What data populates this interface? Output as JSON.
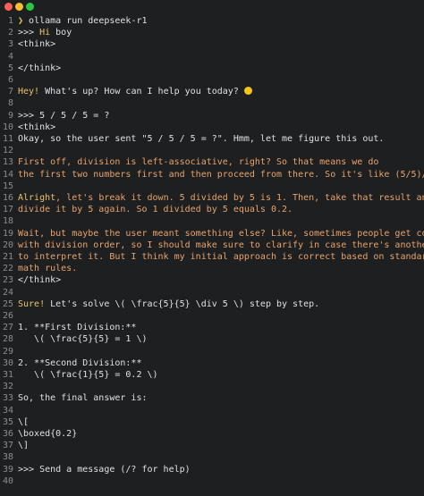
{
  "theme": {
    "background": "#1d1f21",
    "text": "#e0e0e0",
    "accent": "#e9c46a",
    "prose": "#e8a36b",
    "line_numbers": "#8b8d8f"
  },
  "window_controls": [
    "close",
    "minimize",
    "zoom"
  ],
  "lines": [
    {
      "n": "1",
      "pre": "",
      "hl": "❯",
      "rest": " ollama run deepseek-r1",
      "color": "white"
    },
    {
      "n": "2",
      "pre": ">>> ",
      "hl": "Hi",
      "rest": " boy",
      "color": "white"
    },
    {
      "n": "3",
      "pre": "<think>",
      "hl": "",
      "rest": "",
      "color": "white"
    },
    {
      "n": "4",
      "pre": "",
      "hl": "",
      "rest": "",
      "color": "white"
    },
    {
      "n": "5",
      "pre": "</think>",
      "hl": "",
      "rest": "",
      "color": "white"
    },
    {
      "n": "6",
      "pre": "",
      "hl": "",
      "rest": "",
      "color": "white"
    },
    {
      "n": "7",
      "pre": "",
      "hl": "Hey!",
      "rest": " What's up? How can I help you today?",
      "color": "white",
      "emoji": "slightly-smiling-face"
    },
    {
      "n": "8",
      "pre": "",
      "hl": "",
      "rest": "",
      "color": "white"
    },
    {
      "n": "9",
      "pre": ">>> 5 / 5 / 5 = ?",
      "hl": "",
      "rest": "",
      "color": "white"
    },
    {
      "n": "10",
      "pre": "<think>",
      "hl": "",
      "rest": "",
      "color": "white"
    },
    {
      "n": "11",
      "pre": "Okay, so the user sent \"5 / 5 / 5 = ?\". Hmm, let me figure this out.",
      "hl": "",
      "rest": "",
      "color": "white"
    },
    {
      "n": "12",
      "pre": "",
      "hl": "",
      "rest": "",
      "color": "white"
    },
    {
      "n": "13",
      "pre": "First off, division is left-associative, right? So that means we do",
      "hl": "",
      "rest": "",
      "color": "orange"
    },
    {
      "n": "14",
      "pre": "the first two numbers first and then proceed from there. So it's like ",
      "hl": "",
      "rest": "(5/5)/5.",
      "color": "orange"
    },
    {
      "n": "15",
      "pre": "",
      "hl": "",
      "rest": "",
      "color": "white"
    },
    {
      "n": "16",
      "pre": "",
      "hl": "Alright",
      "rest": ", let's break it down. 5 divided by 5 is 1. Then, take that result and",
      "color": "orange"
    },
    {
      "n": "17",
      "pre": "divide it by 5 again. So 1 divided by 5 equals 0.2.",
      "hl": "",
      "rest": "",
      "color": "orange"
    },
    {
      "n": "18",
      "pre": "",
      "hl": "",
      "rest": "",
      "color": "white"
    },
    {
      "n": "19",
      "pre": "Wait, but maybe the user meant something else? Like, sometimes people get confused",
      "hl": "",
      "rest": "",
      "color": "orange"
    },
    {
      "n": "20",
      "pre": "with division order, so I should make sure to clarify in case there's another way",
      "hl": "",
      "rest": "",
      "color": "orange"
    },
    {
      "n": "21",
      "pre": "to interpret it. But I think my initial approach is correct based on standard",
      "hl": "",
      "rest": "",
      "color": "orange"
    },
    {
      "n": "22",
      "pre": "math rules.",
      "hl": "",
      "rest": "",
      "color": "orange"
    },
    {
      "n": "23",
      "pre": "</think>",
      "hl": "",
      "rest": "",
      "color": "white"
    },
    {
      "n": "24",
      "pre": "",
      "hl": "",
      "rest": "",
      "color": "white"
    },
    {
      "n": "25",
      "pre": "",
      "hl": "Sure!",
      "rest": " Let's solve \\( \\frac{5}{5} \\div 5 \\) step by step.",
      "color": "white"
    },
    {
      "n": "26",
      "pre": "",
      "hl": "",
      "rest": "",
      "color": "white"
    },
    {
      "n": "27",
      "pre": "1. **First Division:**",
      "hl": "",
      "rest": "",
      "color": "white"
    },
    {
      "n": "28",
      "pre": "   \\( \\frac{5}{5} = 1 \\)",
      "hl": "",
      "rest": "",
      "color": "white"
    },
    {
      "n": "29",
      "pre": "",
      "hl": "",
      "rest": "",
      "color": "white"
    },
    {
      "n": "30",
      "pre": "2. **Second Division:**",
      "hl": "",
      "rest": "",
      "color": "white"
    },
    {
      "n": "31",
      "pre": "   \\( \\frac{1}{5} = 0.2 \\)",
      "hl": "",
      "rest": "",
      "color": "white"
    },
    {
      "n": "32",
      "pre": "",
      "hl": "",
      "rest": "",
      "color": "white"
    },
    {
      "n": "33",
      "pre": "So, the final answer is:",
      "hl": "",
      "rest": "",
      "color": "white"
    },
    {
      "n": "34",
      "pre": "",
      "hl": "",
      "rest": "",
      "color": "white"
    },
    {
      "n": "35",
      "pre": "\\[",
      "hl": "",
      "rest": "",
      "color": "white"
    },
    {
      "n": "36",
      "pre": "\\boxed{0.2}",
      "hl": "",
      "rest": "",
      "color": "white"
    },
    {
      "n": "37",
      "pre": "\\]",
      "hl": "",
      "rest": "",
      "color": "white"
    },
    {
      "n": "38",
      "pre": "",
      "hl": "",
      "rest": "",
      "color": "white"
    },
    {
      "n": "39",
      "pre": ">>> Send a message (/? for help)",
      "hl": "",
      "rest": "",
      "color": "white"
    },
    {
      "n": "40",
      "pre": "",
      "hl": "",
      "rest": "",
      "color": "white"
    }
  ]
}
